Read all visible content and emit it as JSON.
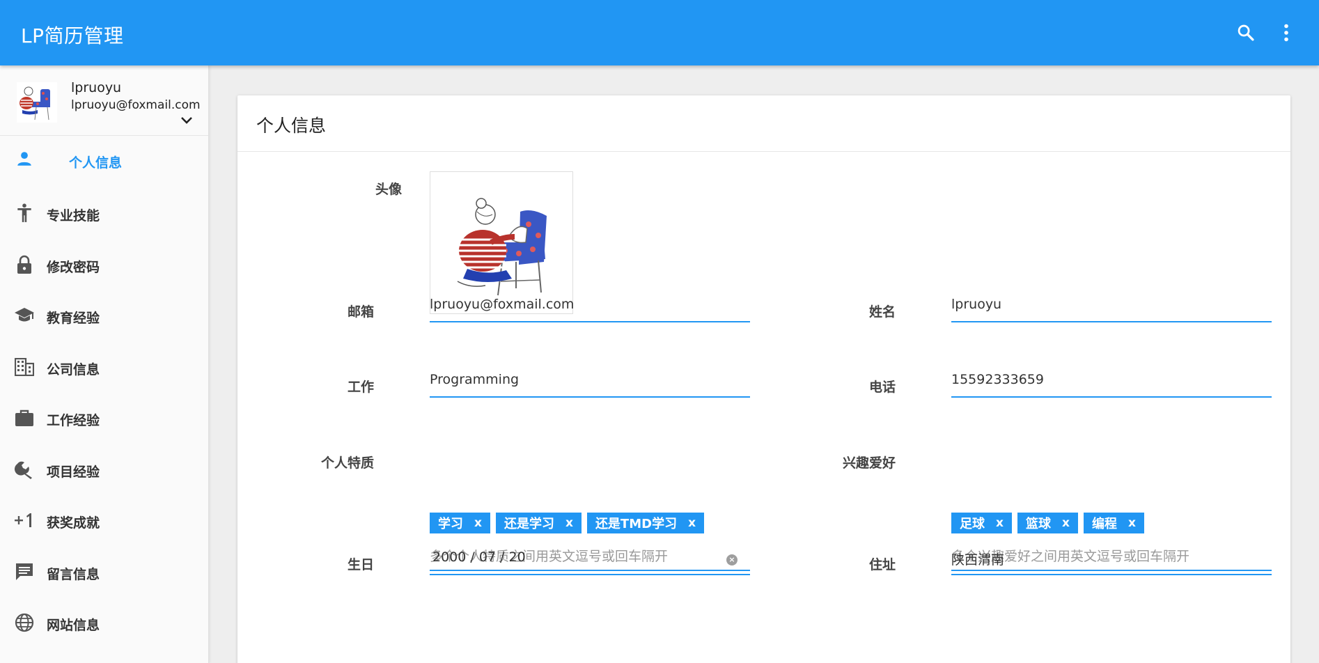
{
  "app": {
    "title": "LP简历管理"
  },
  "user": {
    "name": "lpruoyu",
    "email": "lpruoyu@foxmail.com"
  },
  "sidebar": {
    "items": [
      {
        "label": "个人信息",
        "icon": "person-icon",
        "active": true
      },
      {
        "label": "专业技能",
        "icon": "accessibility-icon"
      },
      {
        "label": "修改密码",
        "icon": "lock-icon"
      },
      {
        "label": "教育经验",
        "icon": "school-icon"
      },
      {
        "label": "公司信息",
        "icon": "business-icon"
      },
      {
        "label": "工作经验",
        "icon": "work-icon"
      },
      {
        "label": "项目经验",
        "icon": "build-icon"
      },
      {
        "label": "获奖成就",
        "icon": "plus-one-icon"
      },
      {
        "label": "留言信息",
        "icon": "comment-icon"
      },
      {
        "label": "网站信息",
        "icon": "globe-icon"
      }
    ]
  },
  "main": {
    "title": "个人信息",
    "form": {
      "avatar_label": "头像",
      "email": {
        "label": "邮箱",
        "value": "lpruoyu@foxmail.com"
      },
      "name": {
        "label": "姓名",
        "value": "lpruoyu"
      },
      "job": {
        "label": "工作",
        "value": "Programming"
      },
      "phone": {
        "label": "电话",
        "value": "15592333659"
      },
      "traits": {
        "label": "个人特质",
        "tags": [
          "学习",
          "还是学习",
          "还是TMD学习"
        ],
        "remove": "x",
        "placeholder": "多个个人特质之间用英文逗号或回车隔开"
      },
      "hobbies": {
        "label": "兴趣爱好",
        "tags": [
          "足球",
          "篮球",
          "编程"
        ],
        "remove": "x",
        "placeholder": "多个兴趣爱好之间用英文逗号或回车隔开"
      },
      "birthday": {
        "label": "生日",
        "value": "2000 / 07 / 20"
      },
      "address": {
        "label": "住址",
        "value": "陕西渭南"
      }
    }
  },
  "colors": {
    "primary": "#2196f3",
    "background": "#eeeeee"
  }
}
